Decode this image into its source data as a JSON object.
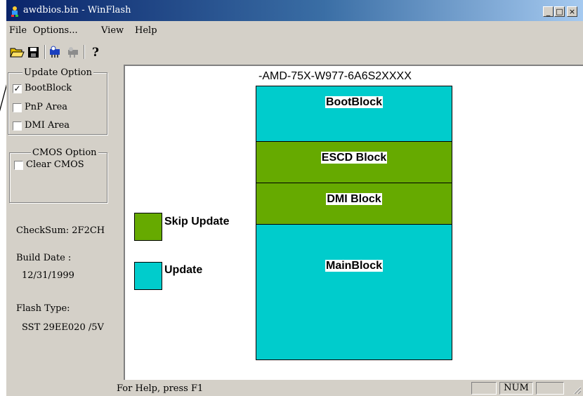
{
  "window": {
    "title": "awdbios.bin - WinFlash",
    "controls": {
      "minimize": "_",
      "maximize": "□",
      "close": "×"
    }
  },
  "menu": {
    "items": [
      {
        "label": "File"
      },
      {
        "label": "Options..."
      },
      {
        "label": "View"
      },
      {
        "label": "Help"
      }
    ]
  },
  "toolbar": {
    "icons": [
      "open-folder-icon",
      "save-disk-icon",
      "flash-chip-icon",
      "flash-tool-icon",
      "help-question-icon"
    ],
    "help_glyph": "?"
  },
  "update_option": {
    "title": "Update Option",
    "items": [
      {
        "label": "BootBlock",
        "checked": true
      },
      {
        "label": "PnP Area",
        "checked": false
      },
      {
        "label": "DMI Area",
        "checked": false
      }
    ]
  },
  "cmos_option": {
    "title": "CMOS Option",
    "items": [
      {
        "label": "Clear CMOS",
        "checked": false
      }
    ]
  },
  "info": {
    "checksum": "CheckSum:  2F2CH",
    "build_date_label": "Build Date :",
    "build_date": "12/31/1999",
    "flash_type_label": "Flash Type:",
    "flash_type": "SST 29EE020 /5V"
  },
  "legend": {
    "skip_label": "Skip Update",
    "update_label": "Update"
  },
  "chip": {
    "title": "-AMD-75X-W977-6A6S2XXXX",
    "blocks": [
      {
        "label": "BootBlock",
        "status": "update"
      },
      {
        "label": "ESCD Block",
        "status": "skip"
      },
      {
        "label": "DMI Block",
        "status": "skip"
      },
      {
        "label": "MainBlock",
        "status": "update"
      }
    ]
  },
  "colors": {
    "update": "#00cccc",
    "skip": "#66aa00",
    "titlebar_start": "#0a246a",
    "titlebar_end": "#a6caf0"
  },
  "status": {
    "help_text": "For Help, press F1",
    "num": "NUM"
  }
}
